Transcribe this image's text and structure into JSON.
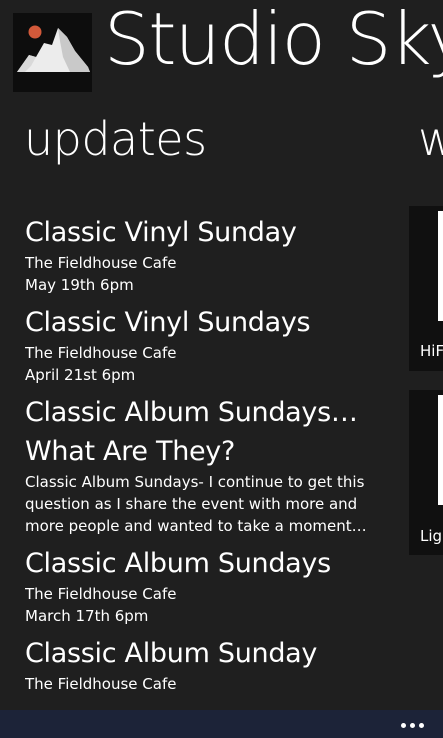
{
  "app": {
    "title": "Studio Sky"
  },
  "section": {
    "title": "updates",
    "next_title_peek": "w"
  },
  "updates": [
    {
      "title": "Classic Vinyl Sunday",
      "lines": [
        "The Fieldhouse Cafe",
        "May 19th 6pm"
      ]
    },
    {
      "title": "Classic Vinyl Sundays",
      "lines": [
        "The Fieldhouse Cafe",
        "April 21st 6pm"
      ]
    },
    {
      "title": "Classic Album Sundays…\nWhat Are They?",
      "title_lines": [
        "Classic Album Sundays…",
        "What Are They?"
      ],
      "lines": [
        "Classic Album Sundays- I continue to get this",
        "question as I share the event with more and",
        "more people and wanted to take a moment…"
      ]
    },
    {
      "title": "Classic Album Sundays",
      "lines": [
        "The Fieldhouse Cafe",
        "March 17th 6pm"
      ]
    },
    {
      "title": "Classic Album Sunday",
      "lines": [
        "The Fieldhouse Cafe"
      ]
    }
  ],
  "side_tiles": [
    {
      "label": "HiF"
    },
    {
      "label": "Ligh"
    }
  ],
  "app_bar": {
    "more_label": "•••"
  },
  "colors": {
    "background": "#1f1f1f",
    "app_bar": "#1c2338",
    "tile": "#101010",
    "text": "#ffffff"
  }
}
